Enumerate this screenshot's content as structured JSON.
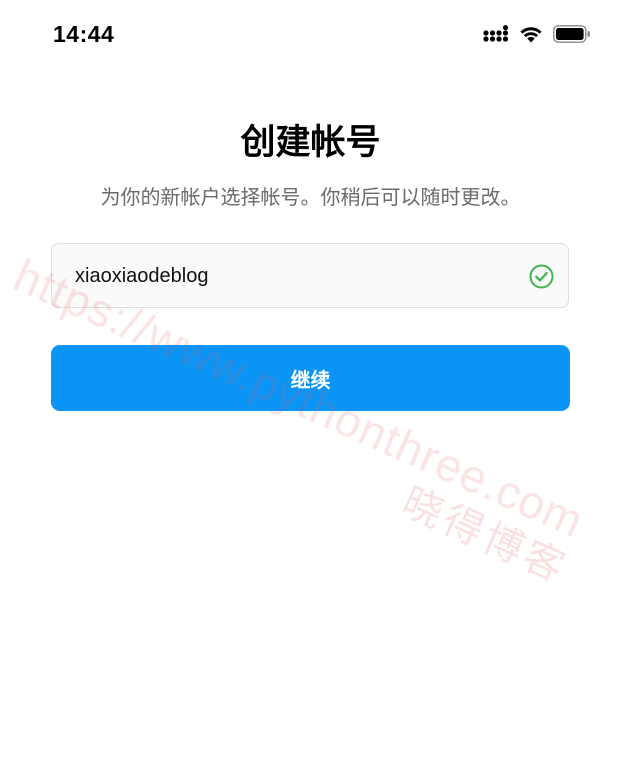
{
  "status_bar": {
    "time": "14:44",
    "icons": [
      "cellular-signal-icon",
      "wifi-icon",
      "battery-icon"
    ]
  },
  "page": {
    "title": "创建帐号",
    "subtitle": "为你的新帐户选择帐号。你稍后可以随时更改。"
  },
  "username": {
    "value": "xiaoxiaodeblog",
    "valid_icon": "check-circle-icon",
    "valid_color": "#3db54a"
  },
  "continue_button": {
    "label": "继续",
    "color": "#0a95f6"
  },
  "watermark": {
    "url": "https://www.pythonthree.com",
    "text": "晓得博客"
  }
}
